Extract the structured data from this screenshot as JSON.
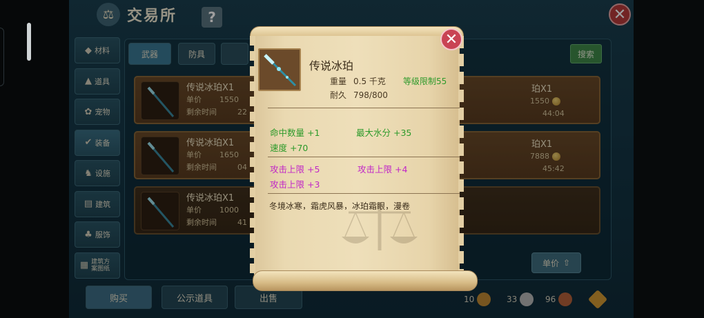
{
  "window": {
    "title": "交易所",
    "help": "?",
    "close": "✕"
  },
  "categories": [
    {
      "label": "材料",
      "icon": "ore-icon"
    },
    {
      "label": "道具",
      "icon": "flask-icon"
    },
    {
      "label": "宠物",
      "icon": "paw-icon"
    },
    {
      "label": "装备",
      "icon": "armor-icon"
    },
    {
      "label": "设施",
      "icon": "horse-icon"
    },
    {
      "label": "建筑",
      "icon": "wall-icon"
    },
    {
      "label": "服饰",
      "icon": "cloth-icon"
    },
    {
      "label": "建筑方案图纸",
      "icon": "blueprint-icon"
    }
  ],
  "tabs": [
    {
      "label": "武器"
    },
    {
      "label": "防具"
    }
  ],
  "search": {
    "label": "搜索"
  },
  "listings": [
    {
      "name": "传说冰珀X1",
      "price_label": "单价",
      "price": "1550",
      "time_label": "剩余时间",
      "time": "22",
      "right_name": "珀X1",
      "right_price": "1550",
      "right_time": "44:04"
    },
    {
      "name": "传说冰珀X1",
      "price_label": "单价",
      "price": "1650",
      "time_label": "剩余时间",
      "time": "04",
      "right_name": "珀X1",
      "right_price": "7888",
      "right_time": "45:42"
    },
    {
      "name": "传说冰珀X1",
      "price_label": "单价",
      "price": "1000",
      "time_label": "剩余时间",
      "time": "41"
    }
  ],
  "sort": {
    "label": "单价",
    "icon": "arrow-up-icon"
  },
  "bottom": {
    "buy": "购买",
    "notice": "公示道具",
    "sell": "出售"
  },
  "currency": [
    {
      "amount": "10",
      "color": "#c08a34"
    },
    {
      "amount": "33",
      "color": "#b9b9b9"
    },
    {
      "amount": "96",
      "color": "#b5623a"
    },
    {
      "amount": "",
      "color": "#d49a32"
    }
  ],
  "tooltip": {
    "item_name": "传说冰珀",
    "weight_label": "重量",
    "weight": "0.5 千克",
    "level_req": "等级限制55",
    "durability_label": "耐久",
    "durability": "798/800",
    "stats_green": [
      "命中数量 +1",
      "最大水分 +35",
      "速度 +70"
    ],
    "stats_purple": [
      "攻击上限 +5",
      "攻击上限 +4",
      "攻击上限 +3"
    ],
    "description": "冬境冰寒，霜虎风暴，冰珀霜眼，漫卷",
    "colors": {
      "green": "#2c9a2a",
      "purple": "#c127c7",
      "close": "#c94354"
    }
  }
}
